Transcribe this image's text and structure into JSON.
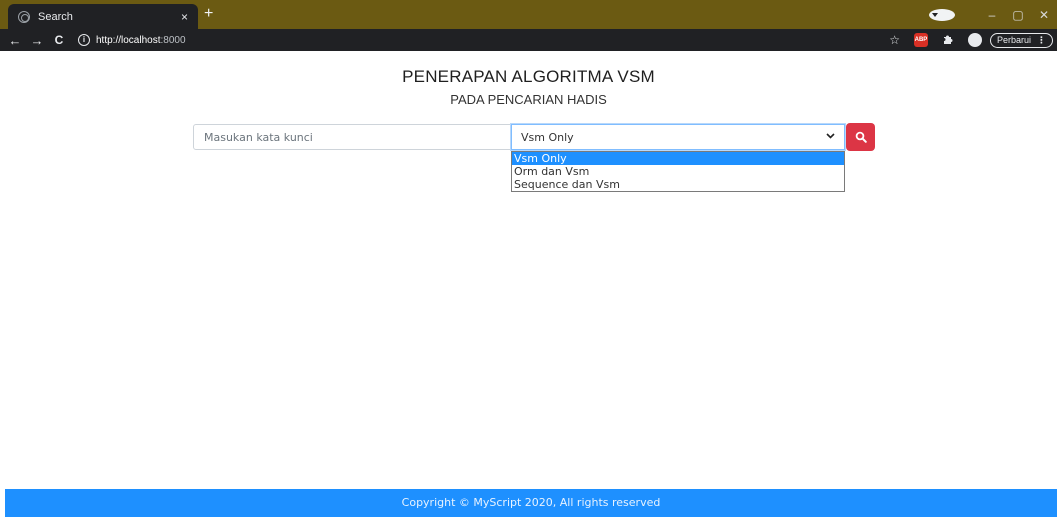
{
  "browser": {
    "tab_title": "Search",
    "tab_close": "×",
    "new_tab": "+",
    "nav_back": "←",
    "nav_forward": "→",
    "nav_reload": "C",
    "url_host": "http://localhost",
    "url_port": ":8000",
    "star": "☆",
    "update_label": "Perbarui",
    "menu_dots": "⋮",
    "icons": {
      "favicon": "globe-icon",
      "info": "info-icon",
      "bookmark": "star-icon",
      "adblock": "abp-icon",
      "extensions": "puzzle-icon",
      "profile": "avatar-icon"
    },
    "window_controls": {
      "minimize": "–",
      "maximize": "▢",
      "close": "✕"
    }
  },
  "page": {
    "title": "PENERAPAN ALGORITMA VSM",
    "subtitle": "PADA PENCARIAN HADIS",
    "search": {
      "placeholder": "Masukan kata kunci",
      "value": ""
    },
    "method_select": {
      "selected": "Vsm Only",
      "options": [
        "Vsm Only",
        "Orm dan Vsm",
        "Sequence dan Vsm"
      ]
    },
    "search_button_icon": "search-icon",
    "footer_text": "Copyright © MyScript 2020, All rights reserved"
  },
  "colors": {
    "tabbar": "#6b5a12",
    "chrome": "#202124",
    "danger": "#dc3545",
    "footer": "#1e90ff",
    "highlight": "#1e90ff"
  }
}
